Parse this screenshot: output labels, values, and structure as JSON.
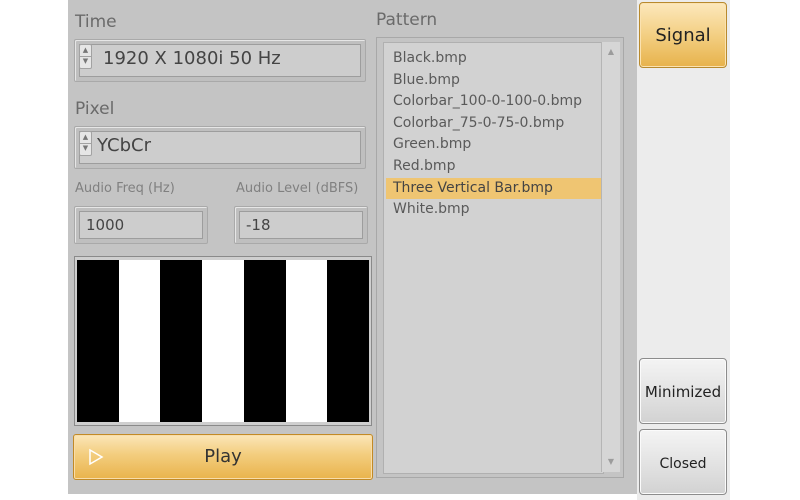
{
  "time": {
    "label": "Time",
    "value": "1920 X 1080i 50 Hz"
  },
  "pixel": {
    "label": "Pixel",
    "value": "YCbCr"
  },
  "audio": {
    "freq_label": "Audio Freq  (Hz)",
    "freq_value": "1000",
    "level_label": "Audio Level  (dBFS)",
    "level_value": "-18"
  },
  "preview": {
    "bars": [
      "#000000",
      "#ffffff",
      "#000000",
      "#ffffff",
      "#000000",
      "#ffffff",
      "#000000"
    ]
  },
  "play_button": {
    "label": "Play",
    "icon": "play-icon"
  },
  "pattern": {
    "label": "Pattern",
    "items": [
      "Black.bmp",
      "Blue.bmp",
      "Colorbar_100-0-100-0.bmp",
      "Colorbar_75-0-75-0.bmp",
      "Green.bmp",
      "Red.bmp",
      "Three Vertical Bar.bmp",
      "White.bmp"
    ],
    "selected_index": 6
  },
  "side": {
    "signal_label": "Signal",
    "minimized_label": "Minimized",
    "closed_label": "Closed"
  },
  "colors": {
    "accent": "#f0c46d",
    "selected": "#efc572",
    "panel": "#c4c4c4"
  }
}
